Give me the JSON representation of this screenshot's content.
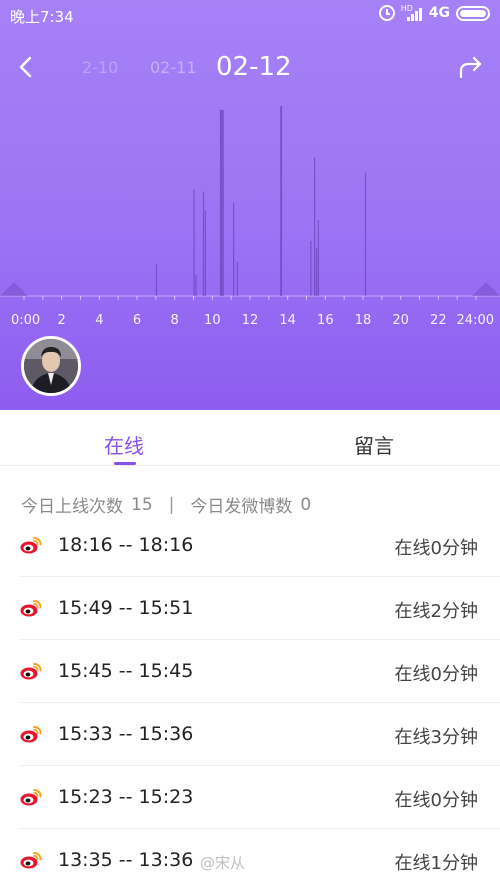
{
  "status_bar": {
    "time": "晚上7:34",
    "hd": "HD",
    "network": "4G"
  },
  "nav": {
    "dates": [
      "2-10",
      "02-11",
      "02-12"
    ]
  },
  "chart_data": {
    "type": "bar",
    "x_ticks": [
      "0:00",
      "2",
      "4",
      "6",
      "8",
      "10",
      "12",
      "14",
      "16",
      "18",
      "20",
      "22",
      "24:00"
    ],
    "xlim": [
      0,
      24
    ],
    "bars": [
      {
        "hour": 7.0,
        "level": 0.17
      },
      {
        "hour": 9.0,
        "level": 0.56
      },
      {
        "hour": 9.1,
        "level": 0.11
      },
      {
        "hour": 9.5,
        "level": 0.55
      },
      {
        "hour": 9.6,
        "level": 0.45
      },
      {
        "hour": 10.4,
        "level": 0.98
      },
      {
        "hour": 10.5,
        "level": 0.98
      },
      {
        "hour": 11.1,
        "level": 0.49
      },
      {
        "hour": 11.3,
        "level": 0.18
      },
      {
        "hour": 13.6,
        "level": 1.0
      },
      {
        "hour": 15.2,
        "level": 0.29
      },
      {
        "hour": 15.4,
        "level": 0.73
      },
      {
        "hour": 15.5,
        "level": 0.25
      },
      {
        "hour": 15.6,
        "level": 0.4
      },
      {
        "hour": 18.1,
        "level": 0.65
      }
    ]
  },
  "tabs": [
    {
      "label": "在线",
      "active": true
    },
    {
      "label": "留言",
      "active": false
    }
  ],
  "summary": {
    "online_count_label": "今日上线次数",
    "online_count": "15",
    "separator": "|",
    "post_count_label": "今日发微博数",
    "post_count": "0"
  },
  "sessions": [
    {
      "time": "18:16 -- 18:16",
      "duration": "在线0分钟"
    },
    {
      "time": "15:49 -- 15:51",
      "duration": "在线2分钟"
    },
    {
      "time": "15:45 -- 15:45",
      "duration": "在线0分钟"
    },
    {
      "time": "15:33 -- 15:36",
      "duration": "在线3分钟"
    },
    {
      "time": "15:23 -- 15:23",
      "duration": "在线0分钟"
    },
    {
      "time": "13:35 -- 13:36",
      "duration": "在线1分钟"
    }
  ],
  "watermark": "@宋从",
  "colors": {
    "accent": "#8752e8",
    "header_top": "#a681f6",
    "header_bottom": "#8e5cf0",
    "weibo_red": "#e6162d",
    "weibo_yellow": "#f5a623"
  }
}
